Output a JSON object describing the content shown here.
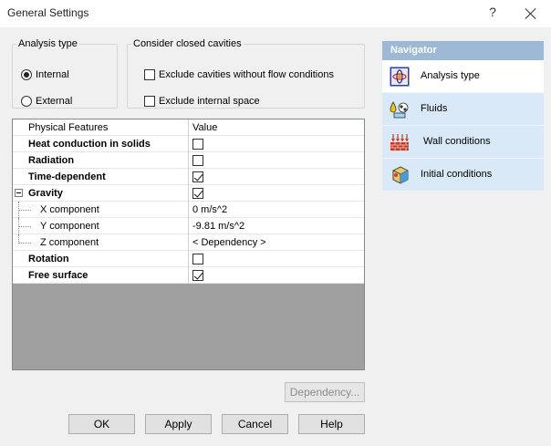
{
  "window": {
    "title": "General Settings",
    "help_glyph": "?"
  },
  "analysis_type": {
    "legend": "Analysis type",
    "options": [
      {
        "label": "Internal",
        "selected": true
      },
      {
        "label": "External",
        "selected": false
      }
    ]
  },
  "closed_cavities": {
    "legend": "Consider closed cavities",
    "options": [
      {
        "label": "Exclude cavities without flow conditions",
        "checked": false
      },
      {
        "label": "Exclude internal space",
        "checked": false
      }
    ]
  },
  "grid": {
    "headers": {
      "name": "Physical Features",
      "value": "Value"
    },
    "rows": [
      {
        "name": "Heat conduction in solids",
        "bold": true,
        "type": "checkbox",
        "checked": false
      },
      {
        "name": "Radiation",
        "bold": true,
        "type": "checkbox",
        "checked": false
      },
      {
        "name": "Time-dependent",
        "bold": true,
        "type": "checkbox",
        "checked": true
      },
      {
        "name": "Gravity",
        "bold": true,
        "type": "checkbox",
        "checked": true,
        "expandable": true,
        "expanded": true
      },
      {
        "name": "X component",
        "bold": false,
        "type": "text",
        "value": "0 m/s^2",
        "child": true
      },
      {
        "name": "Y component",
        "bold": false,
        "type": "text",
        "value": "-9.81 m/s^2",
        "child": true
      },
      {
        "name": "Z component",
        "bold": false,
        "type": "text",
        "value": "< Dependency >",
        "child": true,
        "last_child": true
      },
      {
        "name": "Rotation",
        "bold": true,
        "type": "checkbox",
        "checked": false
      },
      {
        "name": "Free surface",
        "bold": true,
        "type": "checkbox",
        "checked": true
      }
    ]
  },
  "buttons": {
    "dependency": "Dependency...",
    "ok": "OK",
    "apply": "Apply",
    "cancel": "Cancel",
    "help": "Help"
  },
  "navigator": {
    "title": "Navigator",
    "items": [
      {
        "label": "Analysis type",
        "icon": "analysis-type-icon",
        "active": true
      },
      {
        "label": "Fluids",
        "icon": "fluids-icon",
        "active": false
      },
      {
        "label": "Wall conditions",
        "icon": "wall-conditions-icon",
        "active": false
      },
      {
        "label": "Initial conditions",
        "icon": "initial-conditions-icon",
        "active": false
      }
    ]
  },
  "colors": {
    "navigator_header": "#9db9d6",
    "navigator_item": "#d9e9f7",
    "grid_empty": "#a0a0a0"
  }
}
